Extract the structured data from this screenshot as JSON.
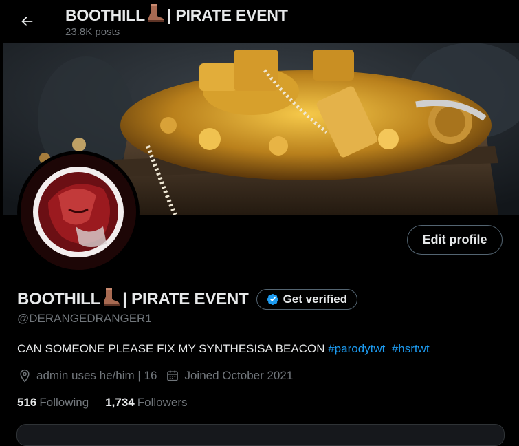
{
  "header": {
    "title_pre": "BOOTHILL",
    "title_post": "| PIRATE EVENT",
    "title_emoji": "boot-emoji",
    "posts_count": "23.8K posts"
  },
  "profile": {
    "name_pre": "BOOTHILL",
    "name_post": "| PIRATE EVENT",
    "get_verified_label": "Get verified",
    "handle": "@DERANGEDRANGER1",
    "edit_profile_label": "Edit profile",
    "bio_text": "CAN SOMEONE PLEASE FIX MY SYNTHESISA BEACON",
    "bio_tags": [
      "#parodytwt",
      "#hsrtwt"
    ],
    "location": "admin uses he/him | 16",
    "joined": "Joined October 2021",
    "following_count": "516",
    "following_label": "Following",
    "followers_count": "1,734",
    "followers_label": "Followers"
  },
  "colors": {
    "background": "#000000",
    "text_primary": "#e7e9ea",
    "text_secondary": "#71767b",
    "link": "#1d9bf0",
    "border": "#536471",
    "verified_badge": "#1d9bf0"
  },
  "icons": {
    "back": "arrow-left-icon",
    "verified": "verified-badge-icon",
    "location": "location-pin-icon",
    "calendar": "calendar-icon"
  }
}
